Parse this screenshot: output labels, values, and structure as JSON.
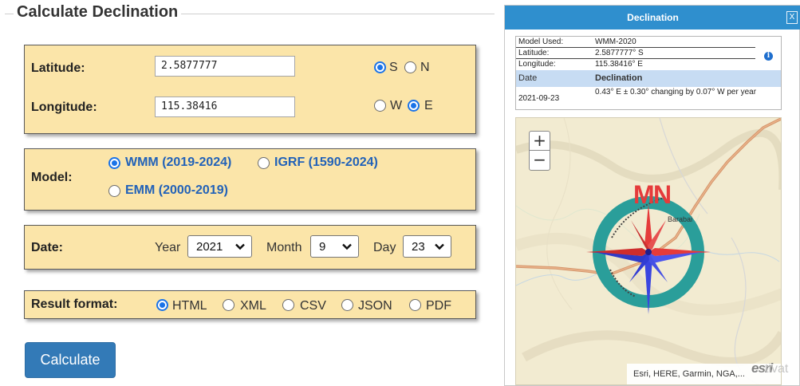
{
  "form": {
    "legend": "Calculate Declination",
    "latitude": {
      "label": "Latitude:",
      "value": "2.5877777",
      "options": [
        "S",
        "N"
      ],
      "selected": "S"
    },
    "longitude": {
      "label": "Longitude:",
      "value": "115.38416",
      "options": [
        "W",
        "E"
      ],
      "selected": "E"
    },
    "model": {
      "label": "Model:",
      "options": [
        "WMM (2019-2024)",
        "IGRF (1590-2024)",
        "EMM (2000-2019)"
      ],
      "selected": "WMM (2019-2024)"
    },
    "date": {
      "label": "Date:",
      "year_label": "Year",
      "year": "2021",
      "month_label": "Month",
      "month": "9",
      "day_label": "Day",
      "day": "23"
    },
    "result_format": {
      "label": "Result format:",
      "options": [
        "HTML",
        "XML",
        "CSV",
        "JSON",
        "PDF"
      ],
      "selected": "HTML"
    },
    "calculate_label": "Calculate"
  },
  "popup": {
    "title": "Declination",
    "close_label": "X",
    "info": [
      {
        "key": "Model Used:",
        "value": "WMM-2020"
      },
      {
        "key": "Latitude:",
        "value": "2.5877777° S"
      },
      {
        "key": "Longitude:",
        "value": "115.38416° E"
      }
    ],
    "table_headers": [
      "Date",
      "Declination"
    ],
    "result": {
      "date": "2021-09-23",
      "declination": "0.43° E  ± 0.30°  changing by  0.07° W per year"
    },
    "info_icon": "i",
    "map": {
      "place_label": "Barabai",
      "zoom_in": "+",
      "zoom_out": "−",
      "attribution": "Esri, HERE, Garmin, NGA,...",
      "compass_letters": {
        "m": "M",
        "n": "N"
      }
    }
  },
  "overlay": {
    "esri_logo": "esri",
    "watermark": "tivat"
  },
  "colors": {
    "panel": "#fbe5a9",
    "accent": "#1a73e8",
    "button": "#337ab7",
    "header": "#2f8fce",
    "compass_ring": "#2a9e9a",
    "compass_red": "#e53b3b",
    "compass_blue": "#3a45e0"
  }
}
